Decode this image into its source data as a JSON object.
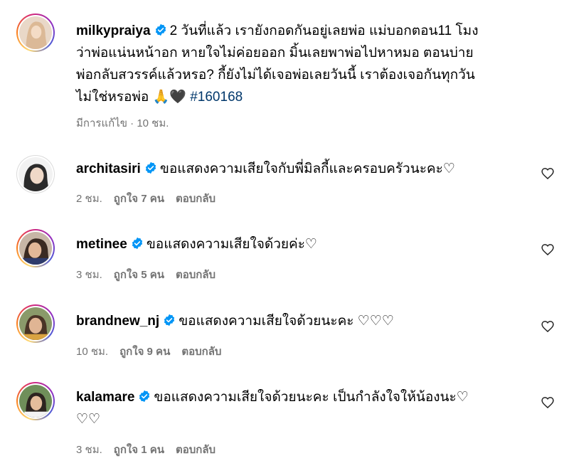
{
  "post": {
    "username": "milkypraiya",
    "caption_line1": "2 วันที่แล้ว เรายังกอดกันอยู่เลยพ่อ แม่บอกตอน11 โมง",
    "caption_line2": "ว่าพ่อแน่นหน้าอก หายใจไม่ค่อยออก มิ้นเลยพาพ่อไปหาหมอ ตอนบ่าย",
    "caption_line3": "พ่อกลับสวรรค์แล้วหรอ? กี้ยังไม่ได้เจอพ่อเลยวันนี้ เราต้องเจอกันทุกวัน",
    "caption_line4": "ไม่ใช่หรอพ่อ",
    "caption_emoji": "🙏🖤",
    "hashtag": "#160168",
    "edited_label": "มีการแก้ไข · 10 ชม."
  },
  "comments": [
    {
      "username": "architasiri",
      "text": "ขอแสดงความเสียใจกับพี่มิลกี้และครอบครัวนะคะ♡",
      "time": "2 ชม.",
      "likes": "ถูกใจ 7 คน",
      "reply": "ตอบกลับ"
    },
    {
      "username": "metinee",
      "text": "ขอแสดงความเสียใจด้วยค่ะ♡",
      "time": "3 ชม.",
      "likes": "ถูกใจ 5 คน",
      "reply": "ตอบกลับ"
    },
    {
      "username": "brandnew_nj",
      "text": "ขอแสดงความเสียใจด้วยนะคะ ♡♡♡",
      "time": "10 ชม.",
      "likes": "ถูกใจ 9 คน",
      "reply": "ตอบกลับ"
    },
    {
      "username": "kalamare",
      "text_line1": "ขอแสดงความเสียใจด้วยนะคะ เป็นกำลังใจให้น้องนะ♡",
      "text_line2": "♡♡",
      "time": "3 ชม.",
      "likes": "ถูกใจ 1 คน",
      "reply": "ตอบกลับ"
    }
  ],
  "colors": {
    "verified": "#0095f6",
    "meta": "#737373",
    "hashtag": "#00376b"
  },
  "icons": {
    "verified": "verified-badge-icon",
    "like": "heart-outline-icon"
  }
}
